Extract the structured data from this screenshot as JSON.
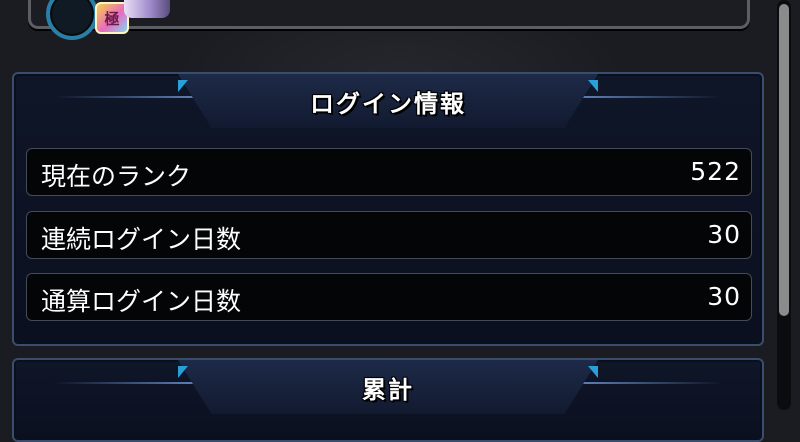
{
  "profile": {
    "badge_text": "極"
  },
  "login_info": {
    "title": "ログイン情報",
    "rows": [
      {
        "label": "現在のランク",
        "value": "522"
      },
      {
        "label": "連続ログイン日数",
        "value": "30"
      },
      {
        "label": "通算ログイン日数",
        "value": "30"
      }
    ]
  },
  "totals": {
    "title": "累計"
  }
}
